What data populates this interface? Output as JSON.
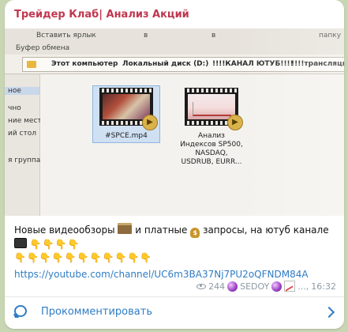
{
  "channel": {
    "name": "Трейдер Клаб| Анализ Акций",
    "name_color": "#c0374f"
  },
  "photo": {
    "ribbon": {
      "paste_shortcut": "Вставить ярлык",
      "clipboard_group": "Буфер обмена",
      "to_label_1": "в",
      "to_label_2": "в",
      "folder_btn": "папку"
    },
    "address_bar": {
      "crumbs": [
        "Этот компьютер",
        "Локальный диск (D:)",
        "!!!!КАНАЛ ЮТУБ!!!!",
        "!!!!трансляции!!"
      ]
    },
    "nav_pane": {
      "items": [
        "ное",
        "чно",
        "ние места",
        "ий стол",
        "я группа"
      ]
    },
    "files": [
      {
        "name": "#SPCE.mp4",
        "selected": true,
        "icon": "video-file-icon"
      },
      {
        "name": "Анализ\nИндексов SP500,\nNASDAQ,\nUSDRUB, EURR...",
        "selected": false,
        "icon": "video-file-icon"
      }
    ]
  },
  "message": {
    "text_part1": "Новые видеообзоры",
    "text_part2": "и платные",
    "text_part3": "запросы, на ютуб канале",
    "pointers_line1": "👇👇👇👇",
    "pointers_line2": "👇👇👇👇👇👇👇👇👇👇👇",
    "link": "https://youtube.com/channel/UC6m3BA37Nj7PU2oQFNDM84A"
  },
  "meta": {
    "views": "244",
    "author": "SEDOY",
    "ellipsis": "...,",
    "time": "16:32"
  },
  "comment": {
    "label": "Прокомментировать"
  },
  "colors": {
    "link": "#2f7cc4",
    "meta": "#8e9aa4"
  }
}
